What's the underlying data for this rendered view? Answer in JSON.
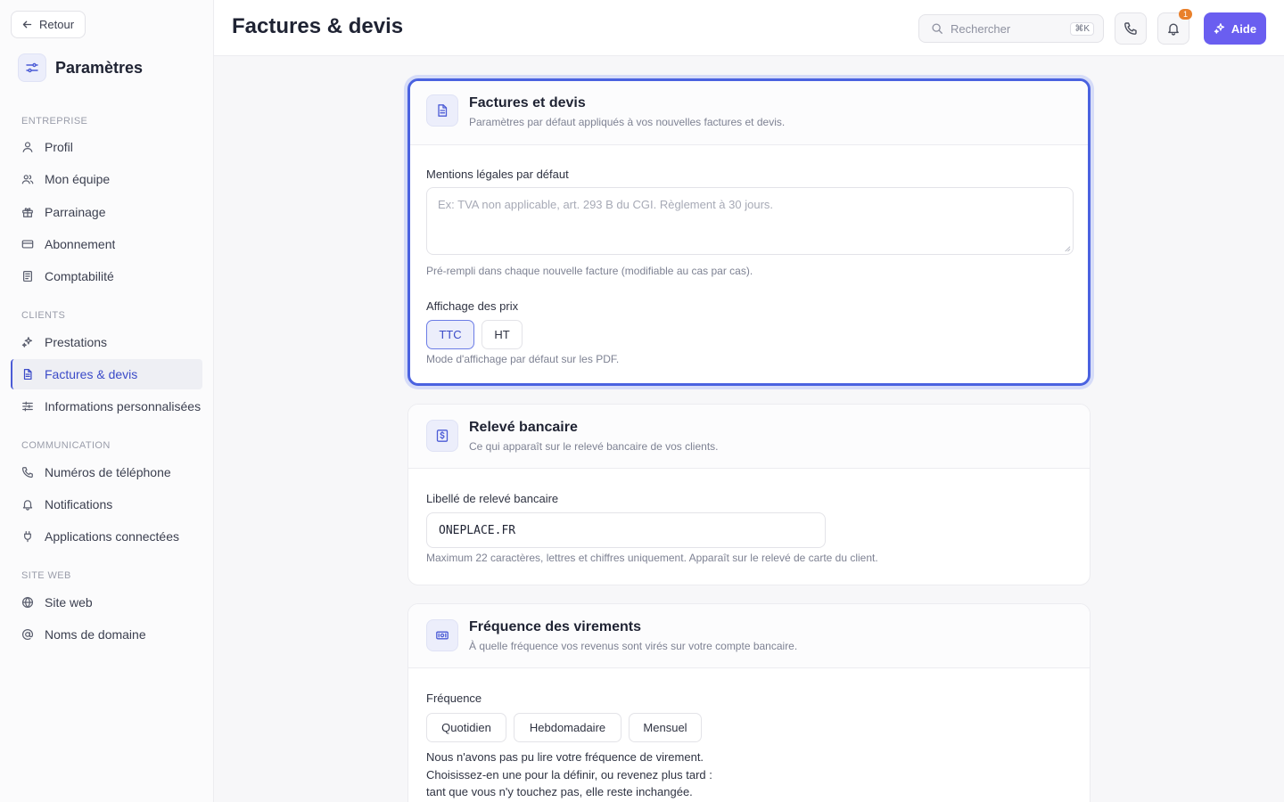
{
  "sidebar": {
    "back_label": "Retour",
    "title": "Paramètres",
    "sections": [
      {
        "label": "ENTREPRISE"
      },
      {
        "label": "CLIENTS"
      },
      {
        "label": "COMMUNICATION"
      },
      {
        "label": "SITE WEB"
      }
    ],
    "items": [
      {
        "label": "Profil",
        "icon": "user-icon"
      },
      {
        "label": "Mon équipe",
        "icon": "users-icon"
      },
      {
        "label": "Parrainage",
        "icon": "gift-icon"
      },
      {
        "label": "Abonnement",
        "icon": "credit-card-icon"
      },
      {
        "label": "Comptabilité",
        "icon": "ledger-icon"
      },
      {
        "label": "Prestations",
        "icon": "sparkles-icon"
      },
      {
        "label": "Factures & devis",
        "icon": "document-icon",
        "active": true
      },
      {
        "label": "Informations personnalisées",
        "icon": "sliders-icon"
      },
      {
        "label": "Numéros de téléphone",
        "icon": "phone-icon"
      },
      {
        "label": "Notifications",
        "icon": "bell-icon"
      },
      {
        "label": "Applications connectées",
        "icon": "plug-icon"
      },
      {
        "label": "Site web",
        "icon": "globe-icon"
      },
      {
        "label": "Noms de domaine",
        "icon": "at-icon"
      }
    ]
  },
  "header": {
    "title": "Factures & devis",
    "search_placeholder": "Rechercher",
    "search_shortcut": "⌘K",
    "notification_count": "1",
    "help_label": "Aide"
  },
  "cards": {
    "invoices": {
      "title": "Factures et devis",
      "subtitle": "Paramètres par défaut appliqués à vos nouvelles factures et devis.",
      "legal_label": "Mentions légales par défaut",
      "legal_placeholder": "Ex: TVA non applicable, art. 293 B du CGI. Règlement à 30 jours.",
      "legal_hint": "Pré-rempli dans chaque nouvelle facture (modifiable au cas par cas).",
      "price_label": "Affichage des prix",
      "price_options": [
        "TTC",
        "HT"
      ],
      "price_selected": "TTC",
      "price_hint": "Mode d'affichage par défaut sur les PDF."
    },
    "bank": {
      "title": "Relevé bancaire",
      "subtitle": "Ce qui apparaît sur le relevé bancaire de vos clients.",
      "label": "Libellé de relevé bancaire",
      "value": "ONEPLACE.FR",
      "hint": "Maximum 22 caractères, lettres et chiffres uniquement. Apparaît sur le relevé de carte du client."
    },
    "payout": {
      "title": "Fréquence des virements",
      "subtitle": "À quelle fréquence vos revenus sont virés sur votre compte bancaire.",
      "label": "Fréquence",
      "options": [
        "Quotidien",
        "Hebdomadaire",
        "Mensuel"
      ],
      "hint_lines": [
        "Nous n'avons pas pu lire votre fréquence de virement.",
        "Choisissez-en une pour la définir, ou revenez plus tard :",
        "tant que vous n'y touchez pas, elle reste inchangée."
      ]
    }
  },
  "colors": {
    "accent": "#4a62e0",
    "help_button": "#6a5ef0",
    "badge": "#e9802b"
  }
}
